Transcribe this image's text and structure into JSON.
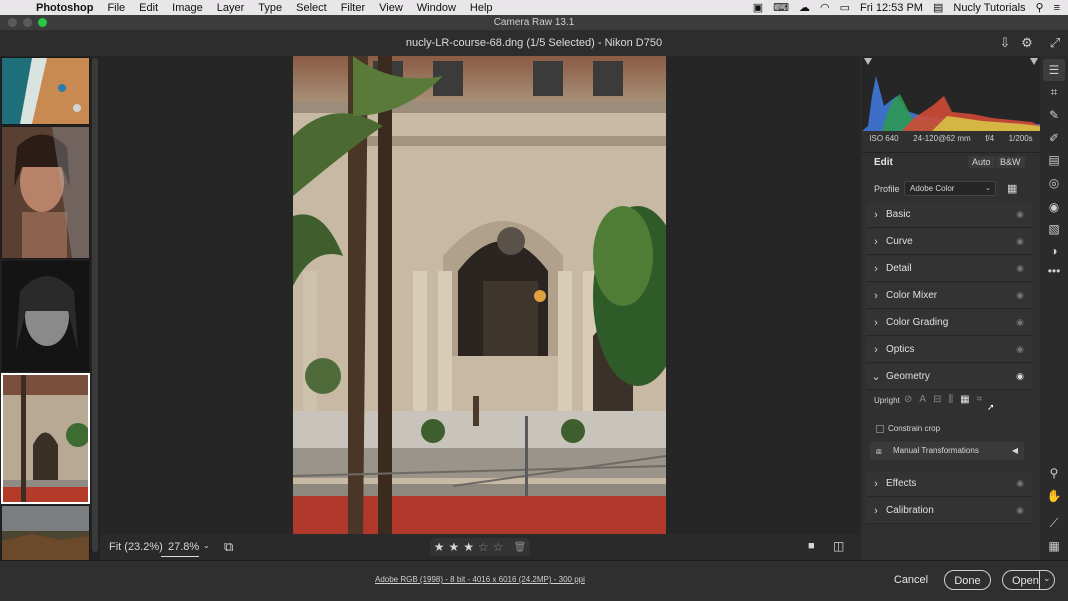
{
  "menubar": {
    "app": "Photoshop",
    "items": [
      "File",
      "Edit",
      "Image",
      "Layer",
      "Type",
      "Select",
      "Filter",
      "View",
      "Window",
      "Help"
    ],
    "clock": "Fri 12:53 PM",
    "user": "Nucly Tutorials"
  },
  "window": {
    "title": "Camera Raw 13.1"
  },
  "doc": {
    "title": "nucly-LR-course-68.dng (1/5 Selected)  -  Nikon D750"
  },
  "canvas_bar": {
    "fit_label": "Fit (23.2%)",
    "zoom_value": "27.8%",
    "rating_stars": 3,
    "rating_max": 5
  },
  "footer": {
    "workflow": "Adobe RGB (1998) - 8 bit - 4016 x 6016 (24.2MP) - 300 ppi",
    "cancel": "Cancel",
    "done": "Done",
    "open": "Open"
  },
  "exif": {
    "iso": "ISO 640",
    "lens": "24-120@62 mm",
    "aperture": "f/4",
    "shutter": "1/200s"
  },
  "edit": {
    "title": "Edit",
    "auto": "Auto",
    "bw": "B&W",
    "profile_label": "Profile",
    "profile_value": "Adobe Color"
  },
  "panels": {
    "basic": "Basic",
    "curve": "Curve",
    "detail": "Detail",
    "mixer": "Color Mixer",
    "grading": "Color Grading",
    "optics": "Optics",
    "geometry": "Geometry",
    "effects": "Effects",
    "calibration": "Calibration"
  },
  "geometry": {
    "upright_label": "Upright",
    "constrain": "Constrain crop",
    "manual": "Manual Transformations"
  },
  "colors": {
    "accent": "#ffffff",
    "panel": "#303030",
    "background": "#2a2a2a"
  }
}
